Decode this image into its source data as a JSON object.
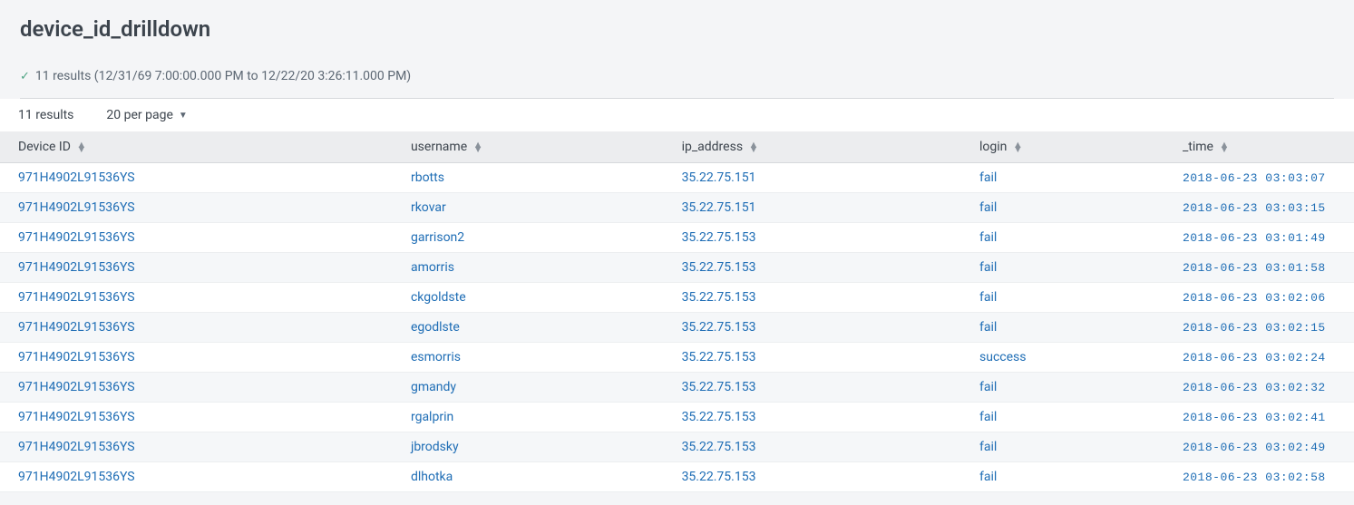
{
  "header": {
    "title": "device_id_drilldown",
    "results_summary": "11 results (12/31/69 7:00:00.000 PM to 12/22/20 3:26:11.000 PM)"
  },
  "controls": {
    "result_count_label": "11 results",
    "per_page_label": "20 per page"
  },
  "table": {
    "columns": [
      {
        "label": "Device ID"
      },
      {
        "label": "username"
      },
      {
        "label": "ip_address"
      },
      {
        "label": "login"
      },
      {
        "label": "_time"
      }
    ],
    "rows": [
      {
        "device_id": "971H4902L91536YS",
        "username": "rbotts",
        "ip_address": "35.22.75.151",
        "login": "fail",
        "time": "2018-06-23 03:03:07"
      },
      {
        "device_id": "971H4902L91536YS",
        "username": "rkovar",
        "ip_address": "35.22.75.151",
        "login": "fail",
        "time": "2018-06-23 03:03:15"
      },
      {
        "device_id": "971H4902L91536YS",
        "username": "garrison2",
        "ip_address": "35.22.75.153",
        "login": "fail",
        "time": "2018-06-23 03:01:49"
      },
      {
        "device_id": "971H4902L91536YS",
        "username": "amorris",
        "ip_address": "35.22.75.153",
        "login": "fail",
        "time": "2018-06-23 03:01:58"
      },
      {
        "device_id": "971H4902L91536YS",
        "username": "ckgoldste",
        "ip_address": "35.22.75.153",
        "login": "fail",
        "time": "2018-06-23 03:02:06"
      },
      {
        "device_id": "971H4902L91536YS",
        "username": "egodlste",
        "ip_address": "35.22.75.153",
        "login": "fail",
        "time": "2018-06-23 03:02:15"
      },
      {
        "device_id": "971H4902L91536YS",
        "username": "esmorris",
        "ip_address": "35.22.75.153",
        "login": "success",
        "time": "2018-06-23 03:02:24"
      },
      {
        "device_id": "971H4902L91536YS",
        "username": "gmandy",
        "ip_address": "35.22.75.153",
        "login": "fail",
        "time": "2018-06-23 03:02:32"
      },
      {
        "device_id": "971H4902L91536YS",
        "username": "rgalprin",
        "ip_address": "35.22.75.153",
        "login": "fail",
        "time": "2018-06-23 03:02:41"
      },
      {
        "device_id": "971H4902L91536YS",
        "username": "jbrodsky",
        "ip_address": "35.22.75.153",
        "login": "fail",
        "time": "2018-06-23 03:02:49"
      },
      {
        "device_id": "971H4902L91536YS",
        "username": "dlhotka",
        "ip_address": "35.22.75.153",
        "login": "fail",
        "time": "2018-06-23 03:02:58"
      }
    ]
  }
}
